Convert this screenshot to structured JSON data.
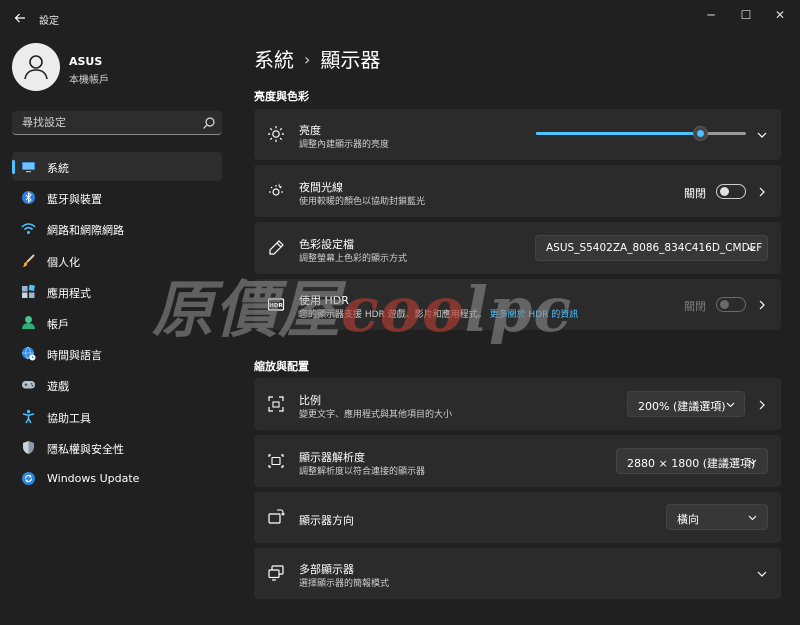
{
  "window": {
    "title": "設定",
    "back_icon": "back-arrow-icon",
    "controls": {
      "minimize": "─",
      "maximize": "☐",
      "close": "✕"
    }
  },
  "user": {
    "name": "ASUS",
    "account_type": "本機帳戶"
  },
  "search": {
    "placeholder": "尋找設定"
  },
  "nav": [
    {
      "label": "系統",
      "icon": "system-icon",
      "active": true
    },
    {
      "label": "藍牙與裝置",
      "icon": "bluetooth-icon"
    },
    {
      "label": "網路和網際網路",
      "icon": "wifi-icon"
    },
    {
      "label": "個人化",
      "icon": "brush-icon"
    },
    {
      "label": "應用程式",
      "icon": "apps-icon"
    },
    {
      "label": "帳戶",
      "icon": "account-icon"
    },
    {
      "label": "時間與語言",
      "icon": "globe-clock-icon"
    },
    {
      "label": "遊戲",
      "icon": "gamepad-icon"
    },
    {
      "label": "協助工具",
      "icon": "accessibility-icon"
    },
    {
      "label": "隱私權與安全性",
      "icon": "shield-icon"
    },
    {
      "label": "Windows Update",
      "icon": "update-icon"
    }
  ],
  "breadcrumb": {
    "parent": "系統",
    "separator": "›",
    "current": "顯示器"
  },
  "sections": {
    "brightness_color": "亮度與色彩",
    "scale_layout": "縮放與配置"
  },
  "brightness": {
    "title": "亮度",
    "subtitle": "調整內建顯示器的亮度",
    "level_percent": 78
  },
  "night_light": {
    "title": "夜間光線",
    "subtitle": "使用較暖的顏色以協助封鎖藍光",
    "state": "關閉"
  },
  "color_profile": {
    "title": "色彩設定檔",
    "subtitle": "調整螢幕上色彩的顯示方式",
    "value": "ASUS_S5402ZA_8086_834C416D_CMDEF"
  },
  "hdr": {
    "title": "使用 HDR",
    "subtitle": "您的顯示器支援 HDR 遊戲、影片和應用程式。",
    "link": "更多關於 HDR 的資訊",
    "state": "關閉"
  },
  "scale": {
    "title": "比例",
    "subtitle": "變更文字、應用程式與其他項目的大小",
    "value": "200% (建議選項)"
  },
  "resolution": {
    "title": "顯示器解析度",
    "subtitle": "調整解析度以符合連接的顯示器",
    "value": "2880 × 1800 (建議選項)"
  },
  "orientation": {
    "title": "顯示器方向",
    "value": "橫向"
  },
  "multi_display": {
    "title": "多部顯示器",
    "subtitle": "選擇顯示器的簡報模式"
  },
  "watermark": {
    "text_a": "原價屋",
    "text_b": "c",
    "text_c": "oo",
    "text_d": "lpc"
  },
  "colors": {
    "accent": "#4cc2ff",
    "background": "#202020",
    "card": "#2b2b2b"
  }
}
